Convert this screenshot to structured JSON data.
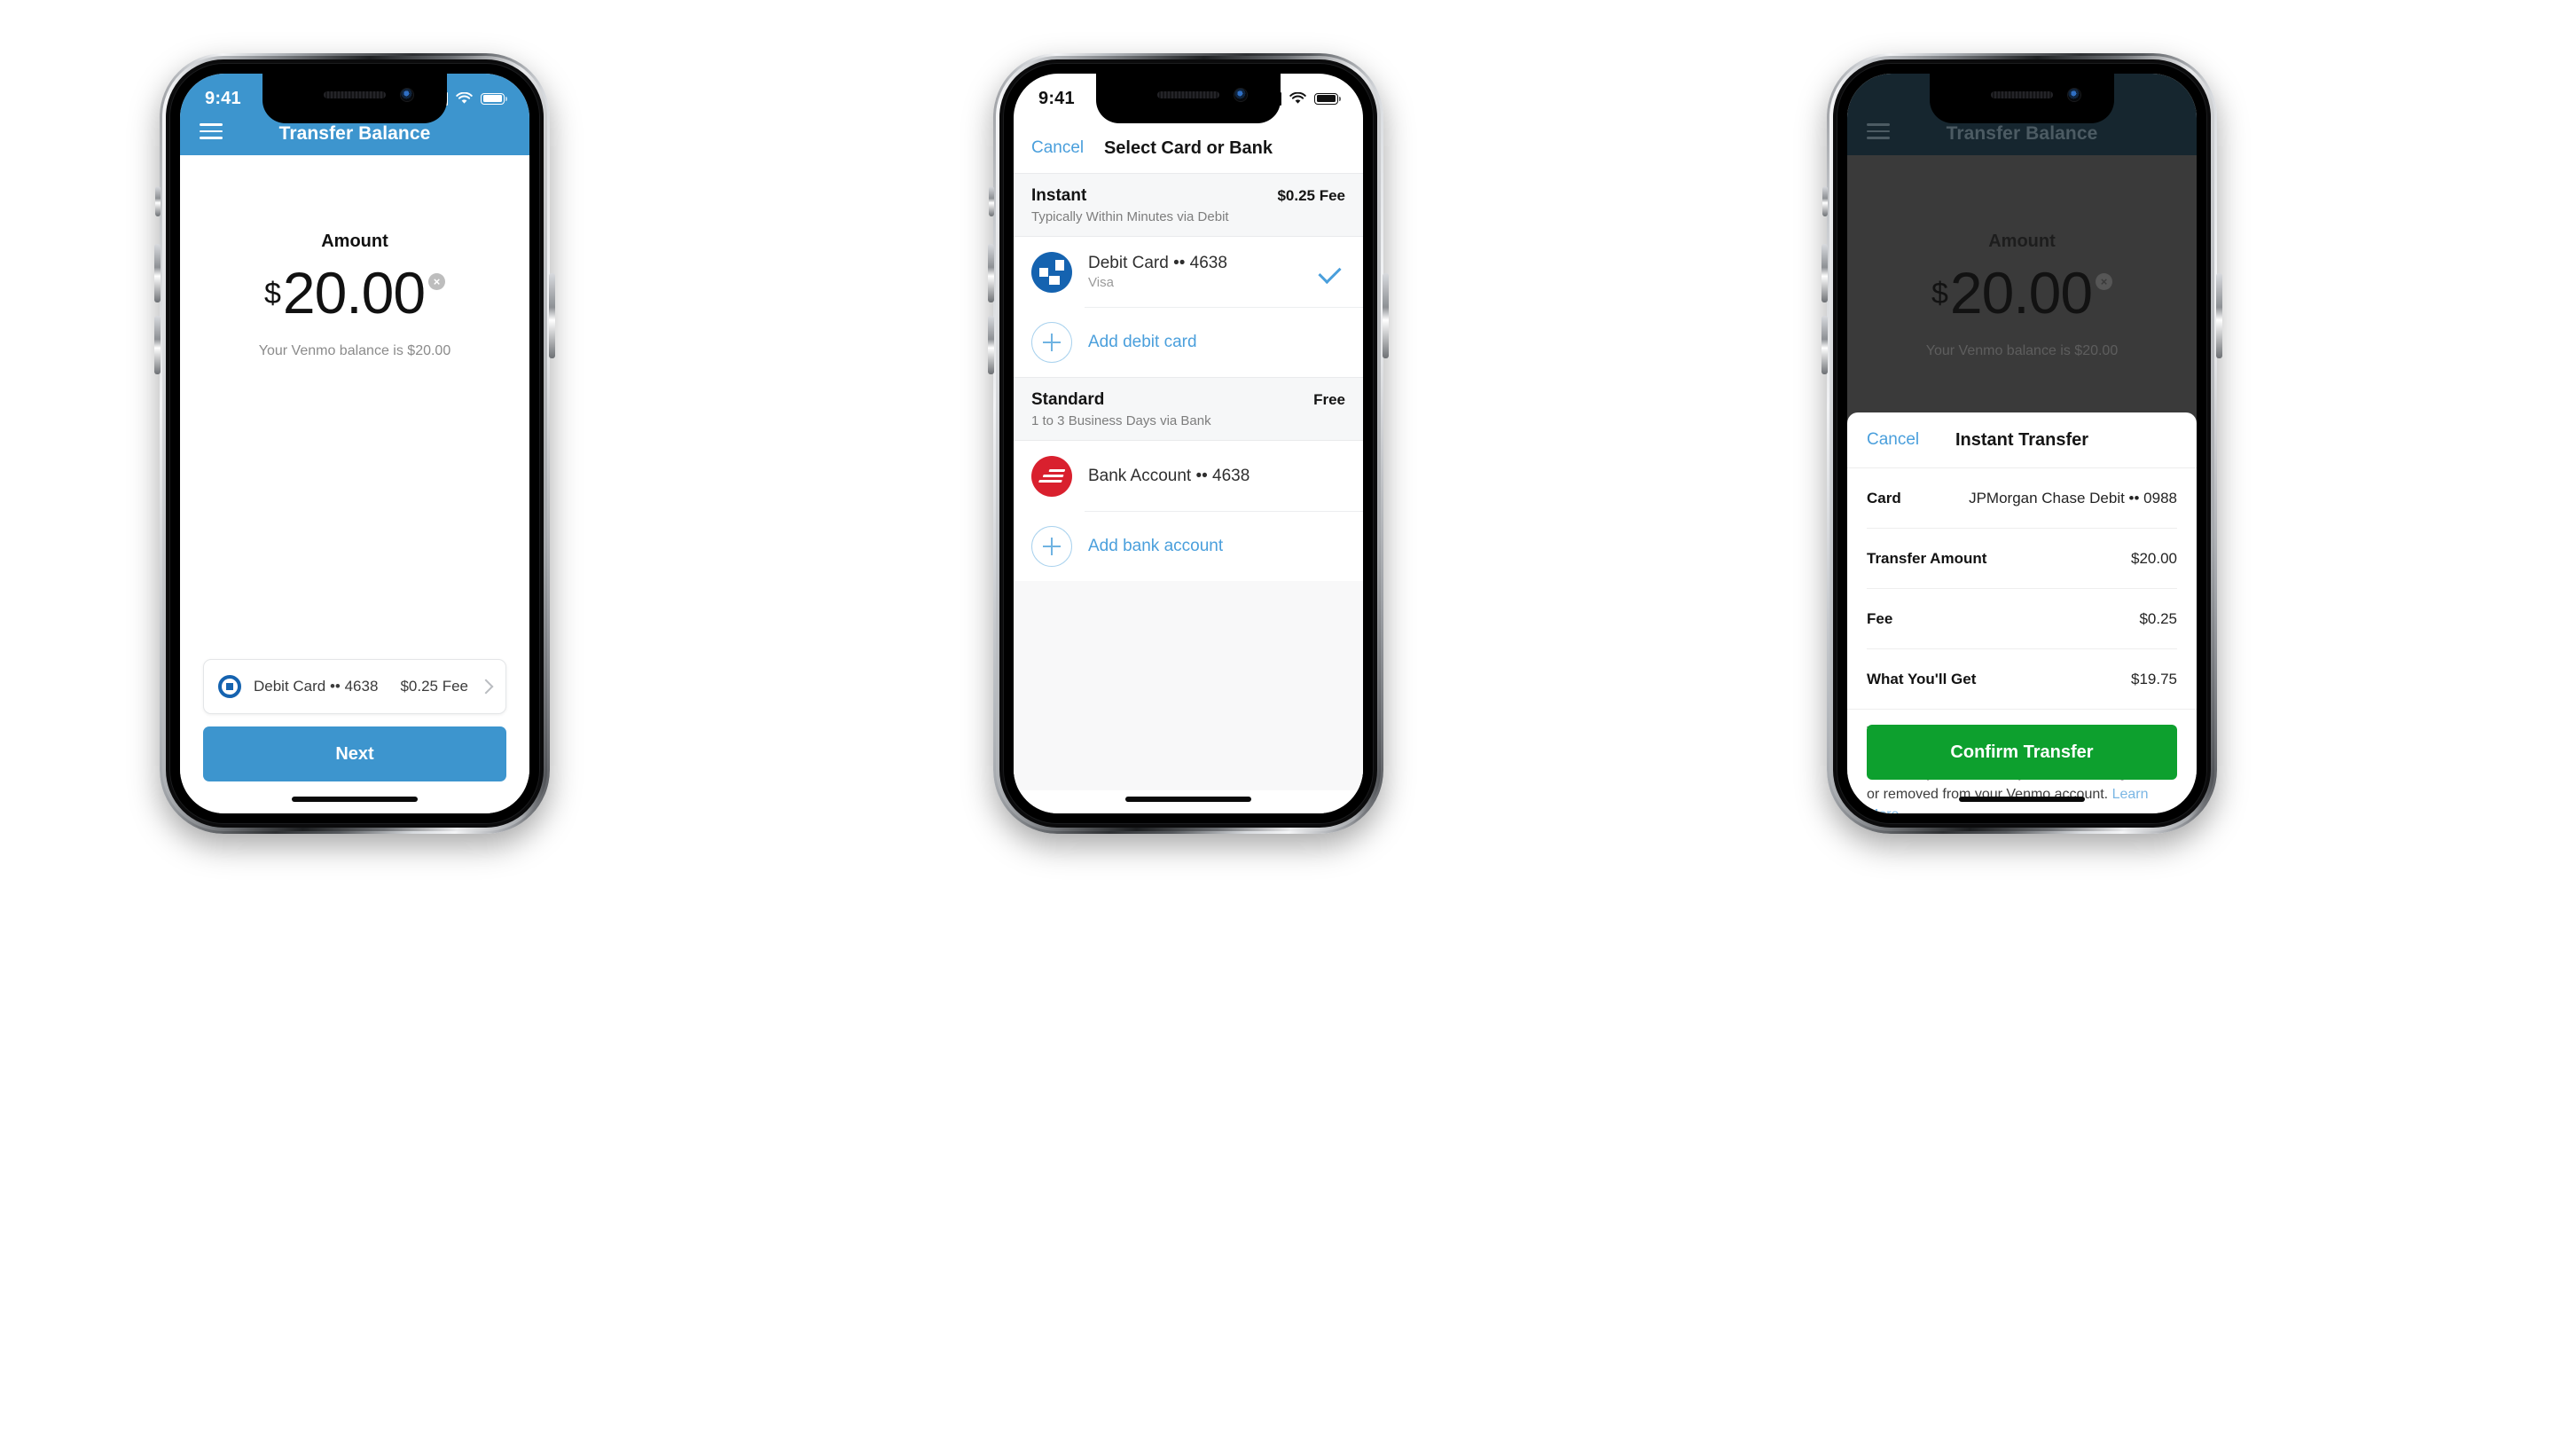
{
  "statusbar": {
    "time": "9:41"
  },
  "screen1": {
    "header_title": "Transfer Balance",
    "menu_icon": "hamburger-menu-icon",
    "amount_label": "Amount",
    "currency_symbol": "$",
    "amount_value": "20.00",
    "clear_icon": "clear-circle-icon",
    "balance_note": "Your Venmo balance is $20.00",
    "card_row": {
      "name": "Debit Card •• 4638",
      "fee": "$0.25 Fee",
      "logo": "chase-logo-icon",
      "chevron": "chevron-right-icon"
    },
    "next_label": "Next"
  },
  "screen2": {
    "cancel_label": "Cancel",
    "title": "Select Card or Bank",
    "sections": [
      {
        "name": "Instant",
        "right": "$0.25  Fee",
        "subtitle": "Typically Within Minutes via Debit",
        "rows": [
          {
            "logo": "chase-logo-icon",
            "title": "Debit Card •• 4638",
            "subtitle": "Visa",
            "selected": true
          }
        ],
        "add_label": "Add debit card"
      },
      {
        "name": "Standard",
        "right": "Free",
        "subtitle": "1 to 3 Business Days via Bank",
        "rows": [
          {
            "logo": "bank-of-america-logo-icon",
            "title": "Bank Account •• 4638",
            "subtitle": "",
            "selected": false
          }
        ],
        "add_label": "Add bank account"
      }
    ]
  },
  "screen3": {
    "header_title": "Transfer Balance",
    "menu_icon": "hamburger-menu-icon",
    "amount_label": "Amount",
    "currency_symbol": "$",
    "amount_value": "20.00",
    "clear_icon": "clear-circle-icon",
    "balance_note": "Your Venmo balance is $20.00",
    "sheet": {
      "cancel_label": "Cancel",
      "title": "Instant Transfer",
      "rows": [
        {
          "label": "Card",
          "value": "JPMorgan Chase Debit •• 0988"
        },
        {
          "label": "Transfer Amount",
          "value": "$20.00"
        },
        {
          "label": "Fee",
          "value": "$0.25"
        },
        {
          "label": "What You'll Get",
          "value": "$19.75"
        }
      ],
      "disclaimer": "Transfer speed depends on your bank and could take up to 30 minutes. Transfers are reviewed which may result in delays or funds being frozen or removed from your Venmo account. ",
      "learn_more": "Learn More...",
      "confirm_label": "Confirm Transfer"
    }
  },
  "colors": {
    "venmo_blue": "#3d95ce",
    "link_blue": "#4a9fdc",
    "confirm_green": "#0da02e",
    "chase_blue": "#1563b0",
    "boa_red": "#d9202e"
  }
}
